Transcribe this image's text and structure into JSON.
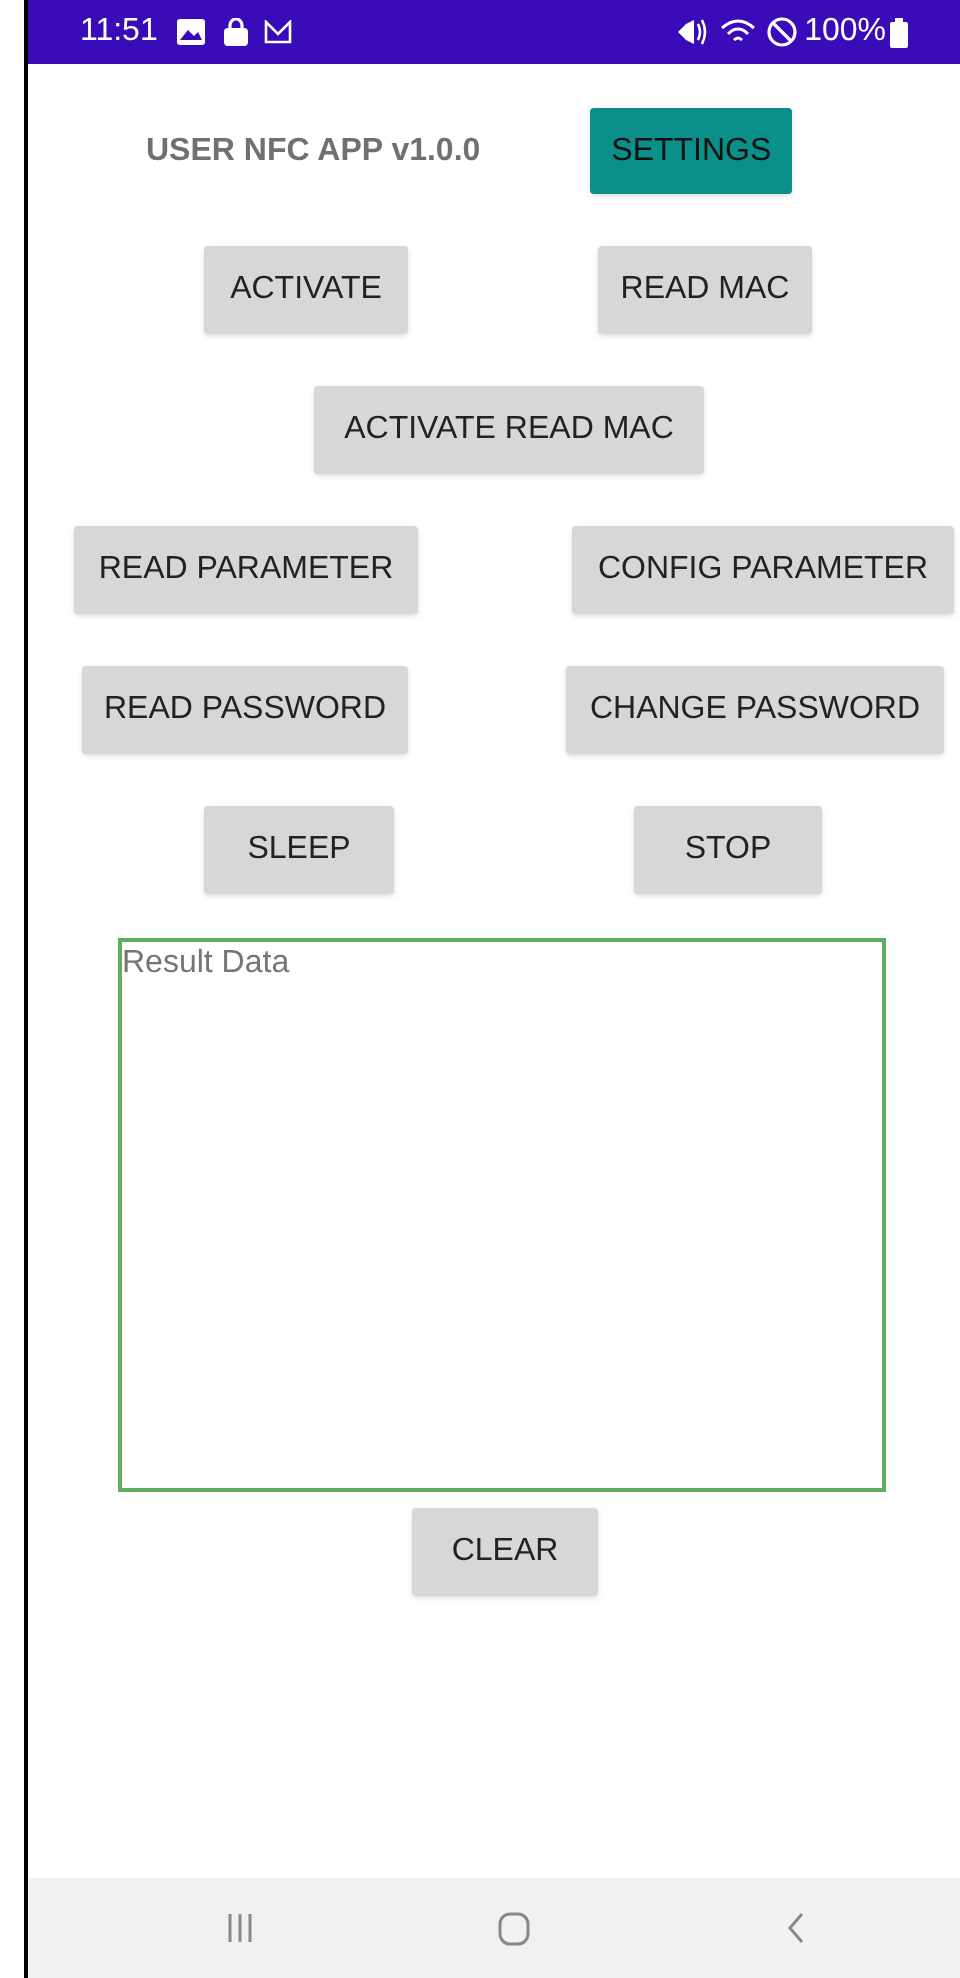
{
  "status_bar": {
    "time": "11:51",
    "battery": "100%"
  },
  "header": {
    "title": "USER NFC APP v1.0.0",
    "settings_button": "SETTINGS"
  },
  "button_rows": [
    [
      "ACTIVATE",
      "READ MAC"
    ],
    [
      "ACTIVATE READ MAC"
    ],
    [
      "READ PARAMETER",
      "CONFIG PARAMETER"
    ],
    [
      "READ PASSWORD",
      "CHANGE PASSWORD"
    ],
    [
      "SLEEP",
      "STOP"
    ]
  ],
  "result_field": {
    "placeholder": "Result Data"
  },
  "clear_button": "CLEAR"
}
